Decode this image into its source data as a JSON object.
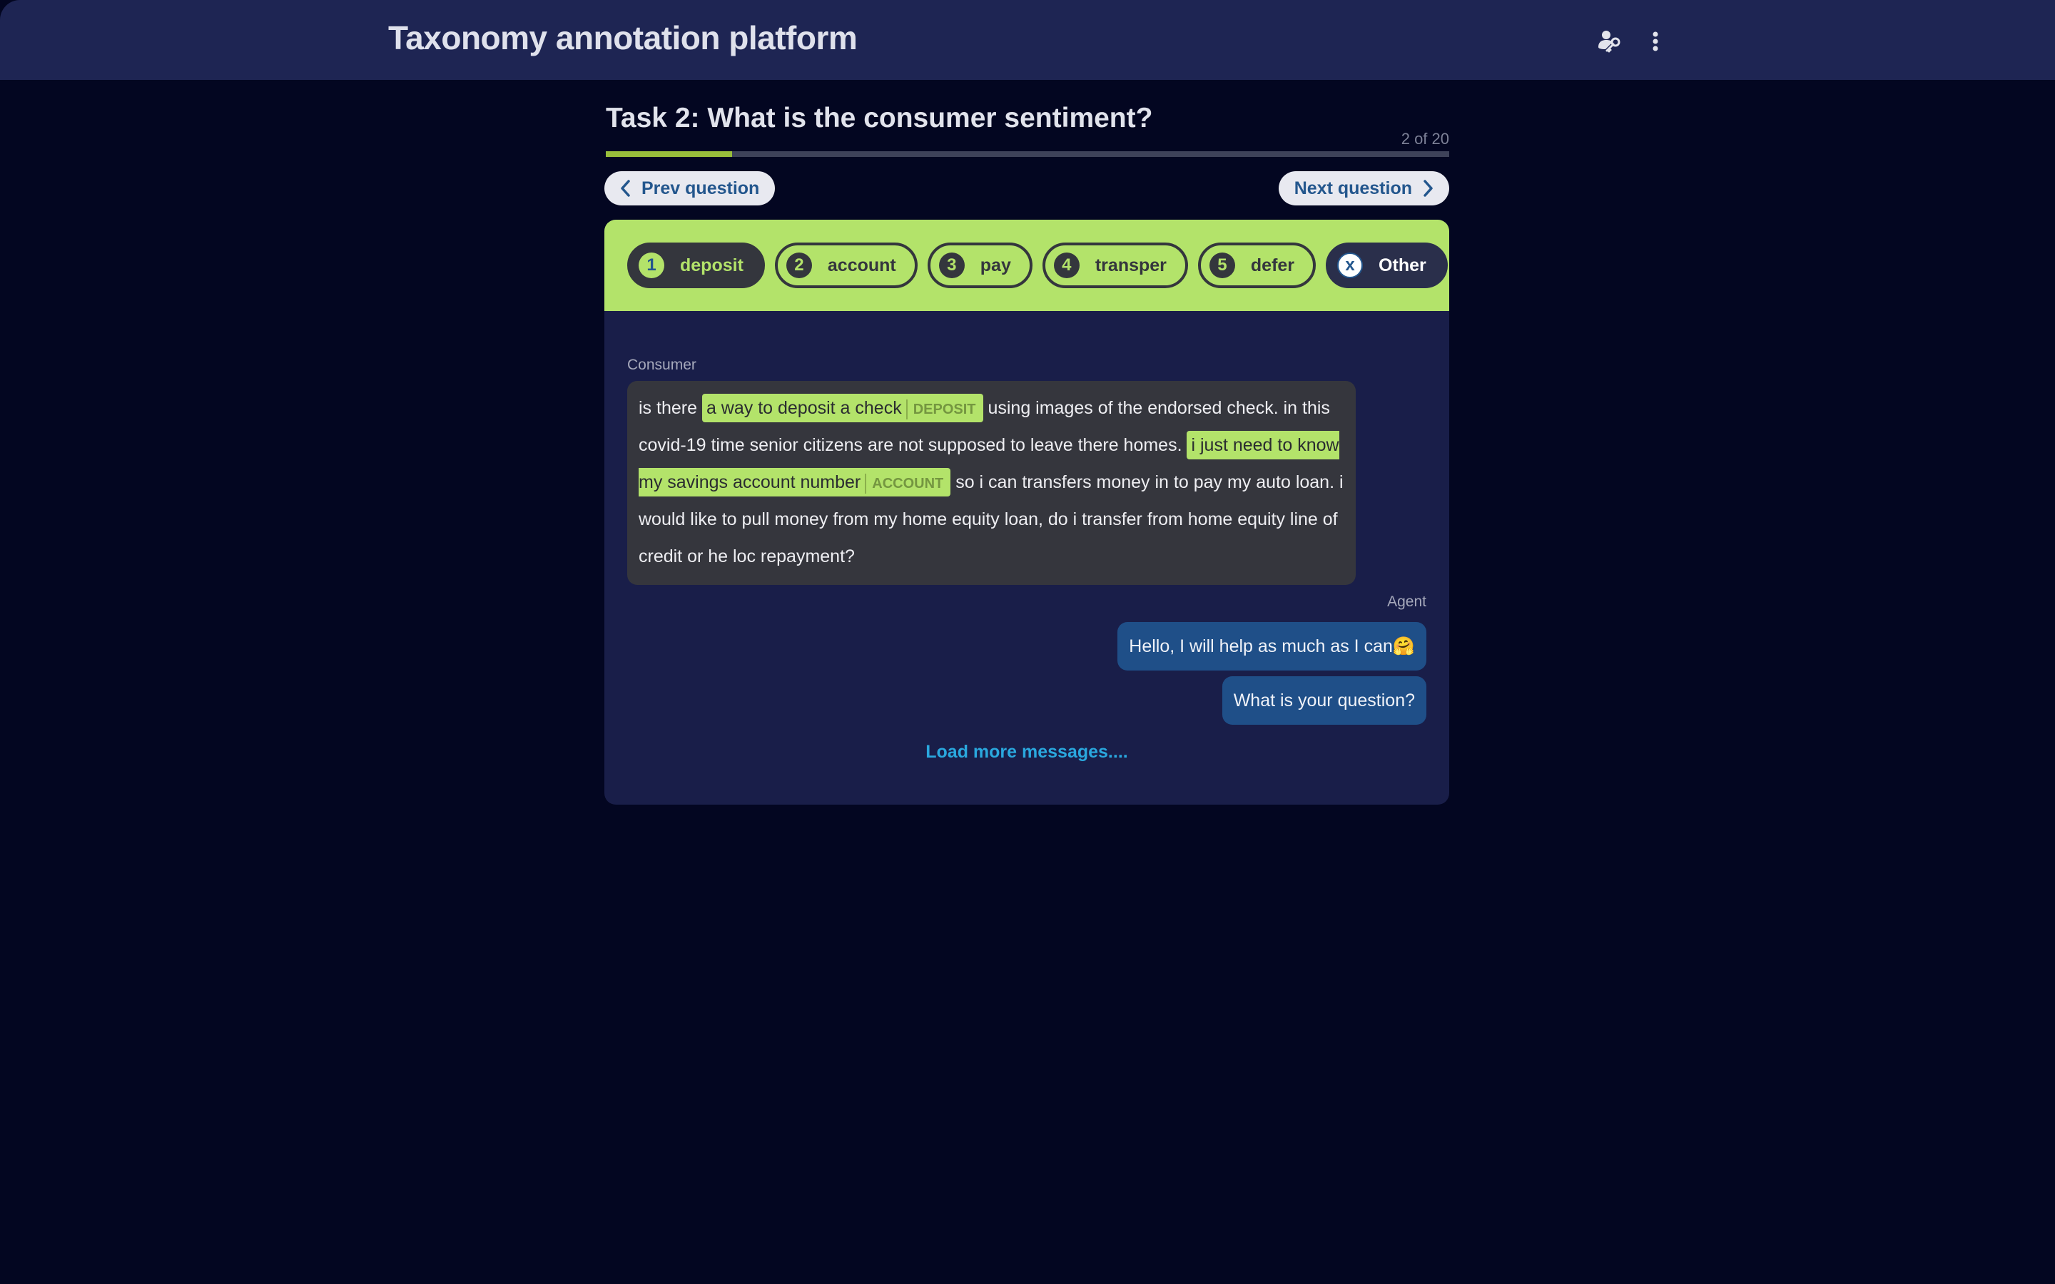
{
  "header": {
    "title": "Taxonomy annotation platform",
    "icons": [
      "user-key-icon",
      "more-vertical-icon"
    ]
  },
  "task": {
    "title": "Task 2: What is the consumer sentiment?",
    "count": "2 of 20",
    "progress_percent": 15
  },
  "nav": {
    "prev_label": "Prev question",
    "next_label": "Next question"
  },
  "labels": [
    {
      "key": "1",
      "name": "deposit",
      "selected": true
    },
    {
      "key": "2",
      "name": "account",
      "selected": false
    },
    {
      "key": "3",
      "name": "pay",
      "selected": false
    },
    {
      "key": "4",
      "name": "transper",
      "selected": false
    },
    {
      "key": "5",
      "name": "defer",
      "selected": false
    },
    {
      "key": "x",
      "name": "Other",
      "selected": false
    }
  ],
  "conversation": {
    "consumer_label": "Consumer",
    "consumer_segments": [
      {
        "text": "is there ",
        "highlight": false
      },
      {
        "text": "a way to deposit a check",
        "highlight": true,
        "tag": "DEPOSIT"
      },
      {
        "text": " using images of the endorsed check. in this covid-19 time senior citizens are not supposed to leave there homes. ",
        "highlight": false
      },
      {
        "text": "i just need to know my savings account number",
        "highlight": true,
        "tag": "ACCOUNT"
      },
      {
        "text": " so i can transfers money in to pay my auto loan. i would like to pull money from my home equity loan, do i transfer from home equity line of credit or he loc repayment?",
        "highlight": false
      }
    ],
    "agent_label": "Agent",
    "agent_messages": [
      "Hello, I will help as much as I can🤗",
      "What is your question?"
    ],
    "load_more_label": "Load more messages...."
  },
  "colors": {
    "header_bg": "#1e2553",
    "page_bg": "#030621",
    "accent_green": "#b3e36a",
    "progress_fill": "#98bd3b",
    "agent_bubble": "#1f4f88",
    "link_blue": "#2aa8de"
  }
}
